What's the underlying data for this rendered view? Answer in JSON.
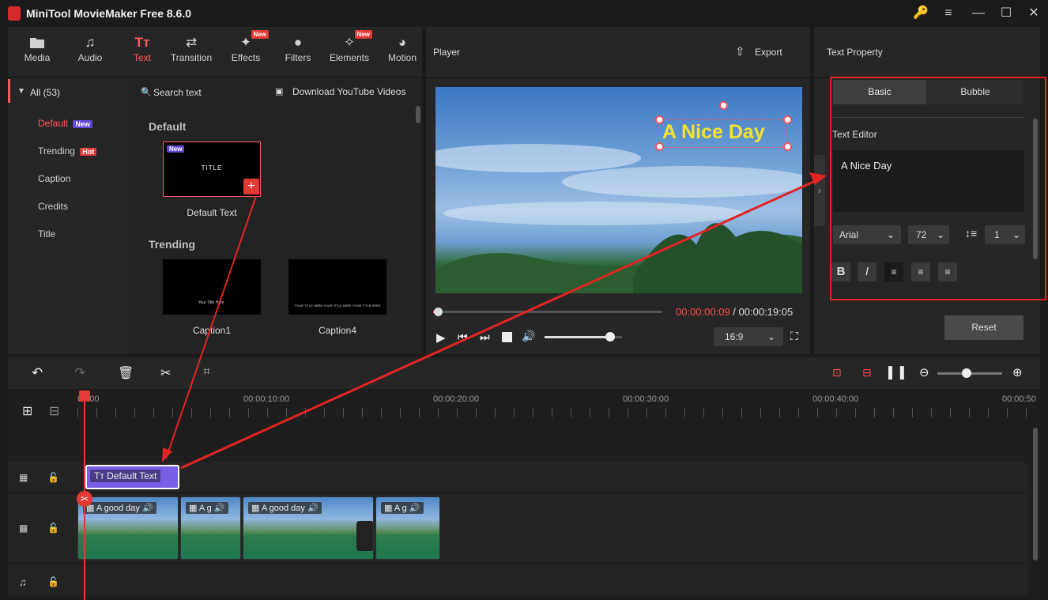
{
  "app": {
    "title": "MiniTool MovieMaker Free 8.6.0"
  },
  "toolbar": {
    "tabs": [
      {
        "label": "Media",
        "icon": "folder-icon"
      },
      {
        "label": "Audio",
        "icon": "music-note-icon"
      },
      {
        "label": "Text",
        "icon": "text-icon"
      },
      {
        "label": "Transition",
        "icon": "transition-icon"
      },
      {
        "label": "Effects",
        "icon": "effects-icon",
        "badge": "New"
      },
      {
        "label": "Filters",
        "icon": "filters-icon"
      },
      {
        "label": "Elements",
        "icon": "elements-icon",
        "badge": "New"
      },
      {
        "label": "Motion",
        "icon": "motion-icon"
      }
    ],
    "active_tab": "Text"
  },
  "categories": {
    "all_label": "All (53)",
    "items": [
      {
        "label": "Default",
        "badge": "New"
      },
      {
        "label": "Trending",
        "badge": "Hot"
      },
      {
        "label": "Caption"
      },
      {
        "label": "Credits"
      },
      {
        "label": "Title"
      }
    ]
  },
  "content": {
    "search_placeholder": "Search text",
    "download_label": "Download YouTube Videos",
    "section_default": "Default",
    "section_trending": "Trending",
    "default_item": {
      "label": "Default Text",
      "thumb_text": "TITLE",
      "badge": "New"
    },
    "trending_items": [
      {
        "label": "Caption1",
        "thumb_text": "Your Title Here"
      },
      {
        "label": "Caption4",
        "thumb_text": "YOUR TITLE HERE YOUR TITLE HERE YOUR TITLE HERE"
      }
    ]
  },
  "player": {
    "title": "Player",
    "export_label": "Export",
    "overlay_text": "A Nice Day",
    "current_time": "00:00:00:09",
    "separator": " / ",
    "total_time": "00:00:19:05",
    "aspect": "16:9",
    "progress": 0.02,
    "volume": 0.85
  },
  "property": {
    "title": "Text Property",
    "tabs": [
      "Basic",
      "Bubble"
    ],
    "active_tab": "Basic",
    "editor_label": "Text Editor",
    "editor_value": "A Nice Day",
    "font": "Arial",
    "size": "72",
    "line_spacing": "1",
    "reset_label": "Reset"
  },
  "timeline": {
    "ruler": [
      "00:00",
      "00:00:10:00",
      "00:00:20:00",
      "00:00:30:00",
      "00:00:40:00",
      "00:00:50"
    ],
    "text_clip_label": "Default Text",
    "video_clips": [
      {
        "label": "A good day"
      },
      {
        "label": "A g"
      },
      {
        "label": "A good day"
      },
      {
        "label": "A g"
      }
    ],
    "zoom": 0.45
  },
  "colors": {
    "accent": "#ff5b5b",
    "annotation": "#e32424",
    "text_overlay": "#f5e32b",
    "text_clip": "#7b5ee6"
  }
}
